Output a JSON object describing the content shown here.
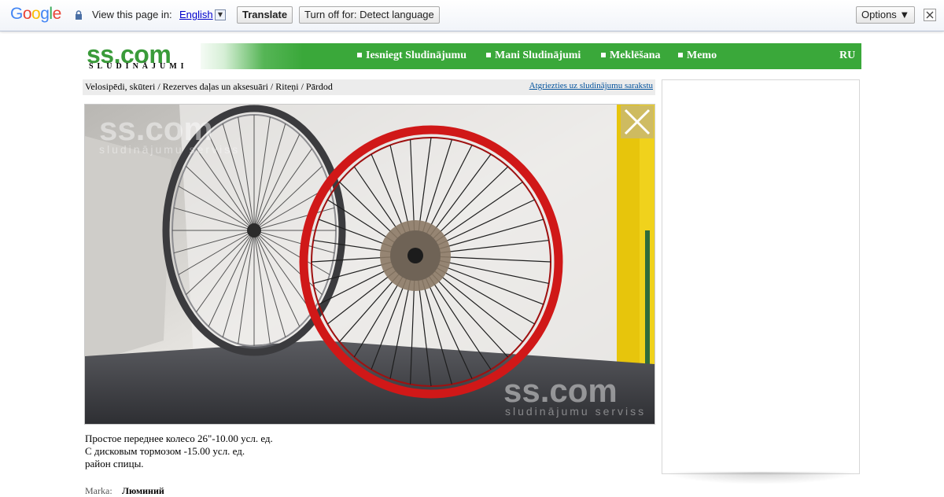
{
  "translate_bar": {
    "logo_letters": [
      {
        "ch": "G",
        "color": "#4285f4"
      },
      {
        "ch": "o",
        "color": "#ea4335"
      },
      {
        "ch": "o",
        "color": "#fbbc05"
      },
      {
        "ch": "g",
        "color": "#4285f4"
      },
      {
        "ch": "l",
        "color": "#34a853"
      },
      {
        "ch": "e",
        "color": "#ea4335"
      }
    ],
    "view_text": "View this page in:",
    "language": "English",
    "translate_label": "Translate",
    "turnoff_label": "Turn off for: Detect language",
    "options_label": "Options ▼",
    "close_glyph": "✕"
  },
  "site": {
    "logo": "ss.com",
    "logo_sub": "SLUDINĀJUMI",
    "nav": [
      {
        "label": "Iesniegt Sludinājumu"
      },
      {
        "label": "Mani Sludinājumi"
      },
      {
        "label": "Meklēšana"
      },
      {
        "label": "Memo"
      }
    ],
    "lang": "RU",
    "accent": "#3aa83a"
  },
  "breadcrumb": {
    "path": "Velosipēdi, skūteri / Rezerves daļas un aksesuāri / Riteņi / Pārdod",
    "back_link": "Atgriezties uz sludinājumu sarakstu"
  },
  "photo": {
    "watermark": "ss.com",
    "watermark_sub": "sludinājumu serviss"
  },
  "description": [
    "Простое переднее колесо 26\"-10.00 усл. ед.",
    "С дисковым тормозом -15.00 усл. ед.",
    "район спицы."
  ],
  "attributes": {
    "marka_label": "Marka:",
    "marka_value": "Люминий"
  }
}
